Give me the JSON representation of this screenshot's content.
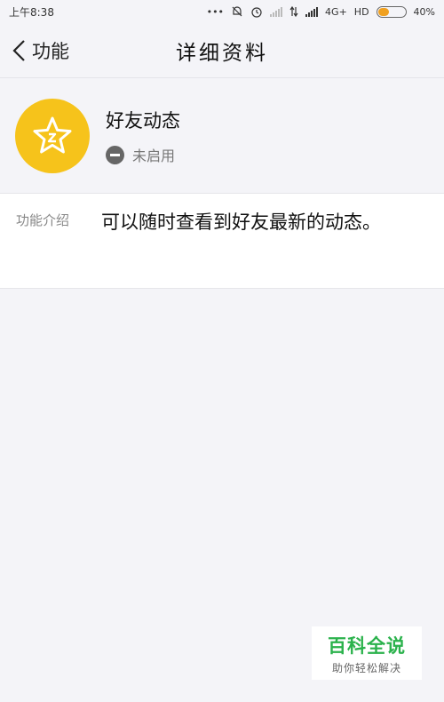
{
  "status_bar": {
    "time": "上午8:38",
    "network": "4G+",
    "hd": "HD",
    "battery": "40%",
    "battery_level": 0.4,
    "icons": [
      "more-dots-icon",
      "mute-bell-icon",
      "alarm-clock-icon",
      "signal-icon",
      "data-arrows-icon",
      "battery-icon"
    ]
  },
  "nav": {
    "back_label": "功能",
    "title": "详细资料"
  },
  "feature": {
    "icon": "star-icon",
    "accent": "#f6c31b",
    "name": "好友动态",
    "status": "未启用"
  },
  "intro": {
    "label": "功能介绍",
    "text": "可以随时查看到好友最新的动态。"
  },
  "watermark": {
    "title": "百科全说",
    "subtitle": "助你轻松解决",
    "color": "#2bb24c"
  }
}
